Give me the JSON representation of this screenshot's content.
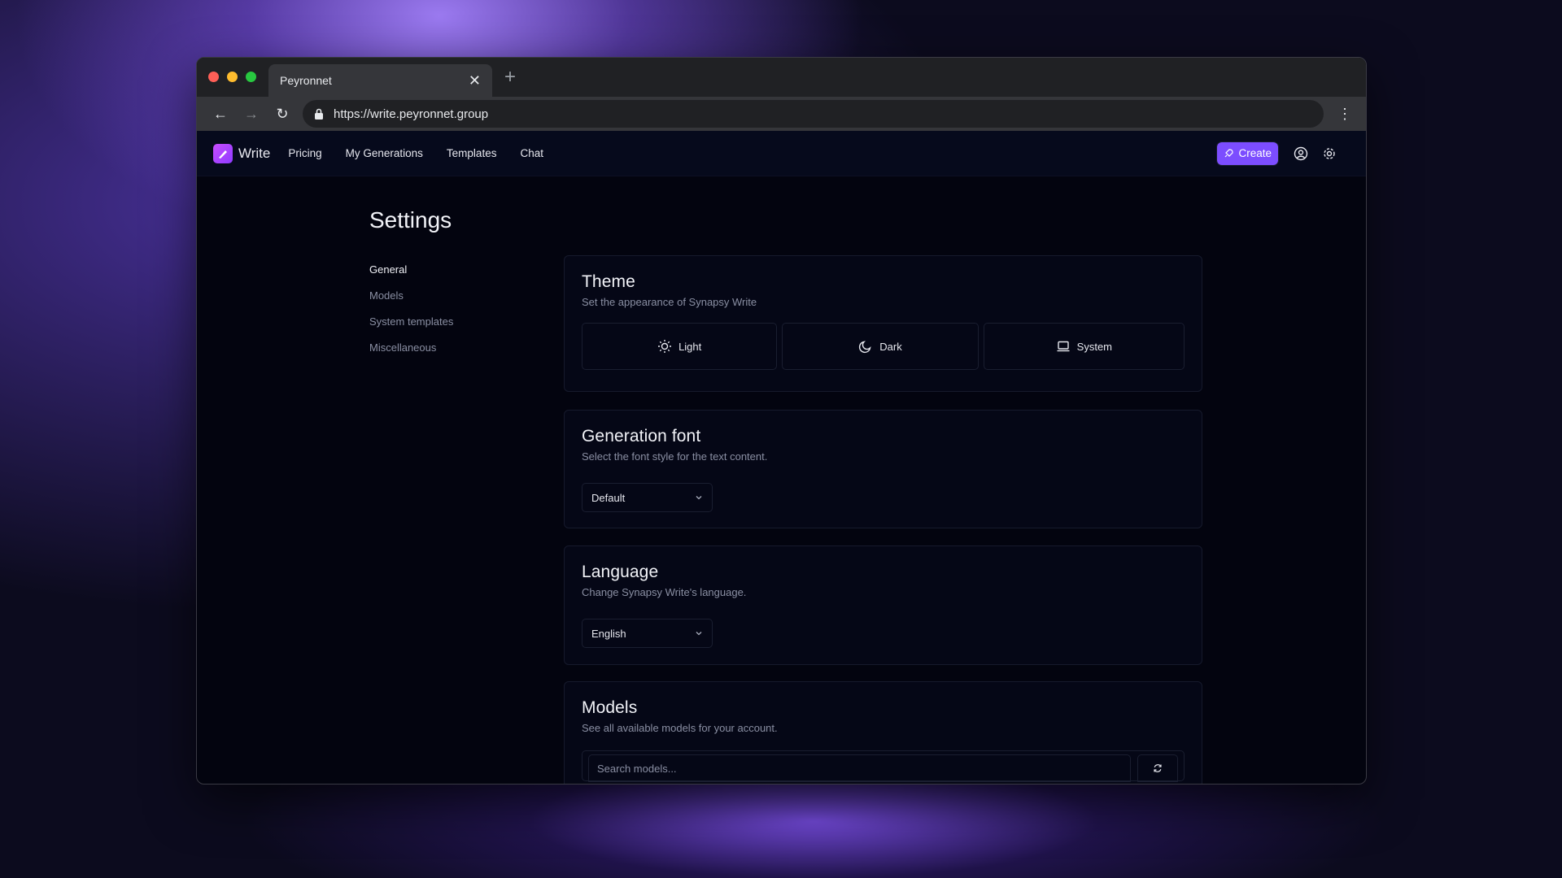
{
  "browser": {
    "tab_title": "Peyronnet",
    "url": "https://write.peyronnet.group",
    "traffic_colors": [
      "#ff5f57",
      "#febc2e",
      "#28c840"
    ]
  },
  "appnav": {
    "brand": "Write",
    "links": [
      "Pricing",
      "My Generations",
      "Templates",
      "Chat"
    ],
    "create_label": "Create",
    "accent": "#7c4dff"
  },
  "page": {
    "title": "Settings",
    "sidenav": [
      "General",
      "Models",
      "System templates",
      "Miscellaneous"
    ],
    "active_section": "General"
  },
  "theme": {
    "title": "Theme",
    "description": "Set the appearance of Synapsy Write",
    "options": [
      {
        "label": "Light",
        "icon": "sun-icon"
      },
      {
        "label": "Dark",
        "icon": "moon-icon"
      },
      {
        "label": "System",
        "icon": "laptop-icon"
      }
    ]
  },
  "font": {
    "title": "Generation font",
    "description": "Select the font style for the text content.",
    "selected": "Default"
  },
  "language": {
    "title": "Language",
    "description": "Change Synapsy Write's language.",
    "selected": "English"
  },
  "models": {
    "title": "Models",
    "description": "See all available models for your account.",
    "search_placeholder": "Search models..."
  }
}
